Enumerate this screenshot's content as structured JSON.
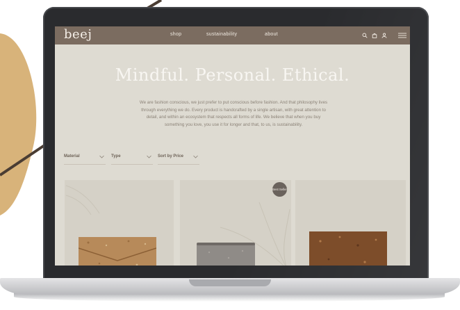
{
  "site": {
    "logo": "beej",
    "nav": [
      {
        "label": "shop"
      },
      {
        "label": "sustainability"
      },
      {
        "label": "about"
      }
    ],
    "nav_icons": [
      "search-icon",
      "bag-icon",
      "user-icon",
      "menu-icon"
    ]
  },
  "hero": {
    "headline": "Mindful. Personal. Ethical.",
    "intro_lines": [
      "We are fashion conscious, we just prefer to put conscious before fashion. And that philosophy lives",
      "through everything we do. Every product is handcrafted by a single artisan, with great attention to",
      "detail, and within an ecosystem that respects all forms of life. We believe that when you buy",
      "something you love, you use it for longer and that, to us, is sustainability."
    ]
  },
  "filters": [
    {
      "label": "Material"
    },
    {
      "label": "Type"
    },
    {
      "label": "Sort by Price"
    }
  ],
  "products": [
    {
      "badge": ""
    },
    {
      "badge": "Best Seller"
    },
    {
      "badge": ""
    }
  ],
  "colors": {
    "nav_bg": "#7b6c60",
    "page_bg": "#dedbd2",
    "accent_blob": "#d8b37a",
    "laptop_frame": "#2a2b2e"
  }
}
